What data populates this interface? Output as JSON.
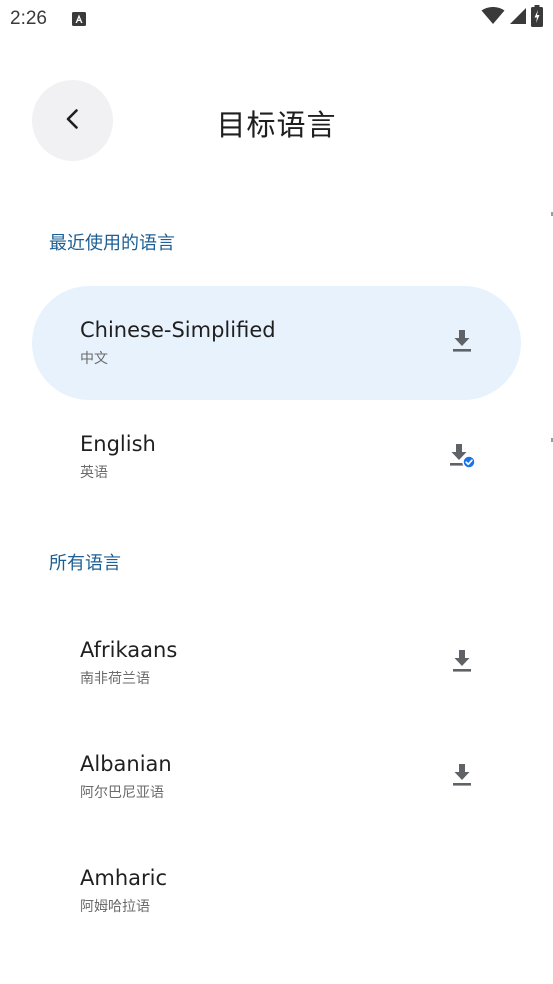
{
  "status_bar": {
    "time": "2:26",
    "icons": [
      "notification-a-icon",
      "wifi-icon",
      "signal-icon",
      "battery-charging-icon"
    ]
  },
  "header": {
    "title": "目标语言",
    "back_icon": "chevron-left-icon"
  },
  "sections": {
    "recent": {
      "title": "最近使用的语言",
      "items": [
        {
          "name": "Chinese-Simplified",
          "native": "中文",
          "status_icon": "download-icon",
          "selected": true
        },
        {
          "name": "English",
          "native": "英语",
          "status_icon": "download-done-icon",
          "selected": false
        }
      ]
    },
    "all": {
      "title": "所有语言",
      "items": [
        {
          "name": "Afrikaans",
          "native": "南非荷兰语",
          "status_icon": "download-icon"
        },
        {
          "name": "Albanian",
          "native": "阿尔巴尼亚语",
          "status_icon": "download-icon"
        },
        {
          "name": "Amharic",
          "native": "阿姆哈拉语",
          "status_icon": ""
        }
      ]
    }
  },
  "colors": {
    "accent": "#1d5f94",
    "selected_bg": "#e7f2fd",
    "icon_gray": "#5f6368",
    "check_blue": "#1a73e8",
    "back_bg": "#f1f1f4"
  }
}
